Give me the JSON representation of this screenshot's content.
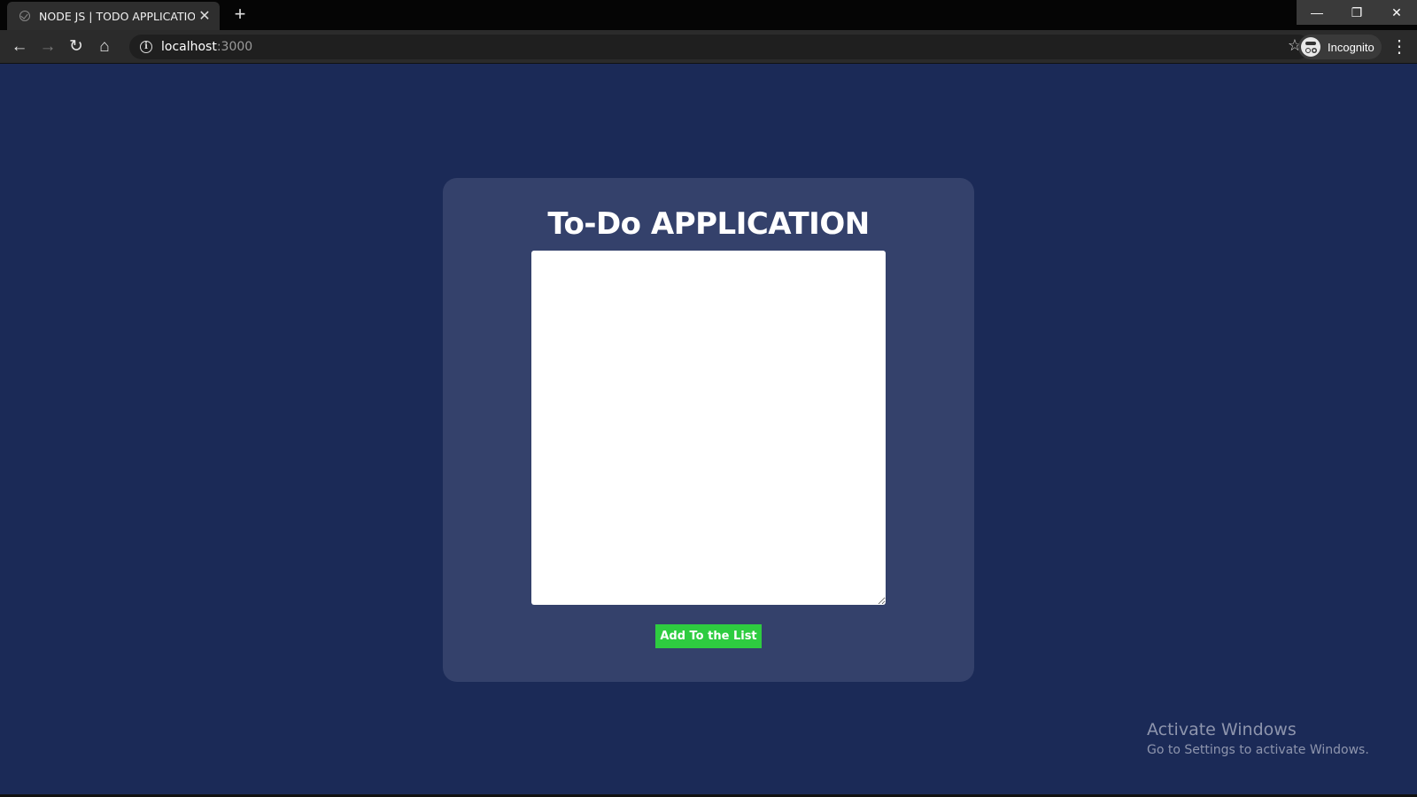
{
  "browser": {
    "tab_title": "NODE JS | TODO APPLICATION",
    "new_tab_symbol": "+",
    "url_host": "localhost",
    "url_port": ":3000",
    "profile_label": "Incognito",
    "icons": [
      "back-arrow-icon",
      "forward-arrow-icon",
      "reload-icon",
      "home-icon",
      "info-icon",
      "star-icon",
      "incognito-icon",
      "menu-icon",
      "close-icon",
      "minimize-icon",
      "restore-icon"
    ]
  },
  "app": {
    "title": "To-Do APPLICATION",
    "textarea_value": "",
    "add_button_label": "Add To the List",
    "colors": {
      "page_background": "#1b2a57",
      "card_background": "#34416b",
      "button_background": "#2ecc40",
      "text": "#ffffff"
    }
  },
  "os_watermark": {
    "line1": "Activate Windows",
    "line2": "Go to Settings to activate Windows."
  }
}
